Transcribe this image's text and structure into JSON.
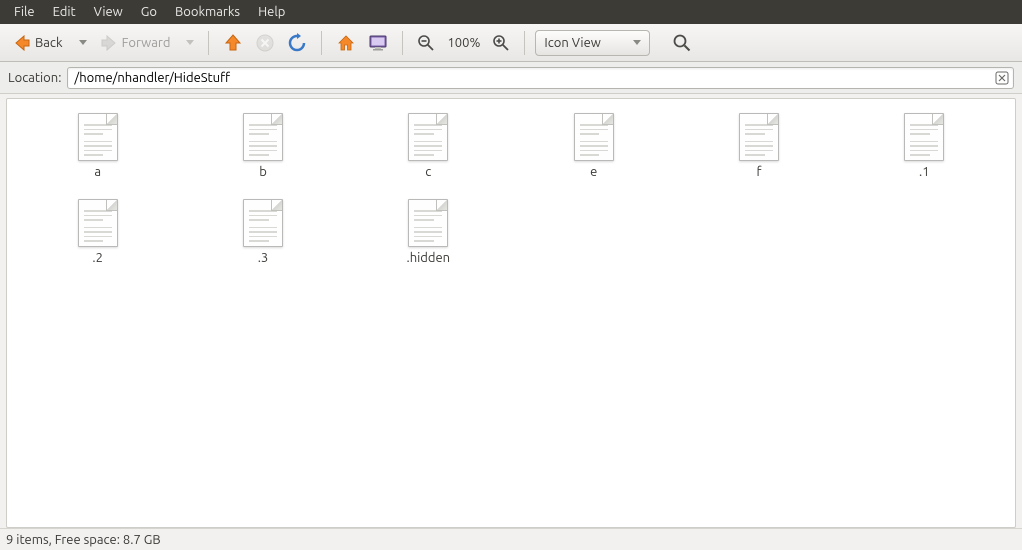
{
  "menubar": [
    "File",
    "Edit",
    "View",
    "Go",
    "Bookmarks",
    "Help"
  ],
  "toolbar": {
    "back_label": "Back",
    "forward_label": "Forward",
    "zoom_text": "100%",
    "view_select": "Icon View"
  },
  "location": {
    "label": "Location:",
    "path": "/home/nhandler/HideStuff"
  },
  "files": [
    {
      "name": "a"
    },
    {
      "name": "b"
    },
    {
      "name": "c"
    },
    {
      "name": "e"
    },
    {
      "name": "f"
    },
    {
      "name": ".1"
    },
    {
      "name": ".2"
    },
    {
      "name": ".3"
    },
    {
      "name": ".hidden"
    }
  ],
  "status": "9 items, Free space: 8.7 GB"
}
